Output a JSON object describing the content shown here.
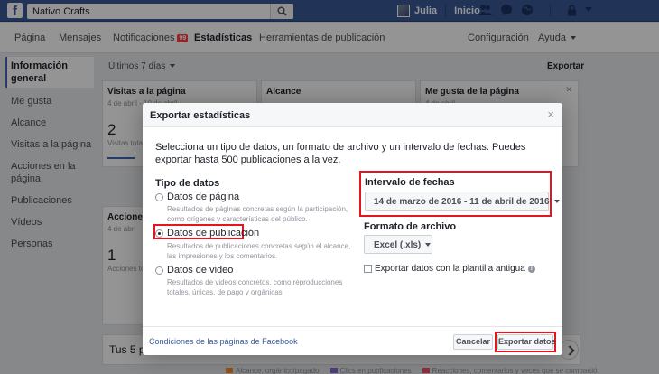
{
  "topbar": {
    "search_value": "Nativo Crafts",
    "user_name": "Julia",
    "home_label": "Inicio"
  },
  "pagenav": {
    "items": [
      "Página",
      "Mensajes",
      "Notificaciones",
      "Estadísticas",
      "Herramientas de publicación"
    ],
    "notif_badge": "99",
    "settings": "Configuración",
    "help": "Ayuda"
  },
  "sidebar": {
    "items": [
      "Información general",
      "Me gusta",
      "Alcance",
      "Visitas a la página",
      "Acciones en la página",
      "Publicaciones",
      "Vídeos",
      "Personas"
    ]
  },
  "main": {
    "range": "Últimos 7 días",
    "export": "Exportar",
    "cards": [
      {
        "title": "Visitas a la página",
        "sub": "4 de abril - 10 de abril",
        "value": "2",
        "small": "Visitas tota"
      },
      {
        "title": "Alcance",
        "sub": "",
        "value": "",
        "small": ""
      },
      {
        "title": "Me gusta de la página",
        "sub": "4 de abril",
        "value": "",
        "small": ""
      },
      {
        "title": "Accione",
        "sub": "4 de abri",
        "value": "1",
        "small": "Acciones to"
      }
    ],
    "bottom_title": "Tus 5 p",
    "legend": [
      "Alcance: orgánico/pagado",
      "Clics en publicaciones",
      "Reacciones, comentarios y veces que se compartió"
    ]
  },
  "modal": {
    "title": "Exportar estadísticas",
    "close": "×",
    "intro": "Selecciona un tipo de datos, un formato de archivo y un intervalo de fechas. Puedes exportar hasta 500 publicaciones a la vez.",
    "data_type_title": "Tipo de datos",
    "options": [
      {
        "label": "Datos de página",
        "desc": "Resultados de páginas concretas según la participación, como orígenes y características del público."
      },
      {
        "label": "Datos de publicación",
        "desc": "Resultados de publicaciones concretas según el alcance, las impresiones y los comentarios."
      },
      {
        "label": "Datos de video",
        "desc": "Resultados de videos concretos, como reproducciones totales, únicas, de pago y orgánicas"
      }
    ],
    "selected_option": 1,
    "date_range_title": "Intervalo de fechas",
    "date_range_value": "14 de marzo de 2016 - 11 de abril de 2016",
    "format_title": "Formato de archivo",
    "format_value": "Excel (.xls)",
    "legacy_checkbox": "Exportar datos con la plantilla antigua",
    "footer_link": "Condiciones de las páginas de Facebook",
    "cancel": "Cancelar",
    "export": "Exportar datos"
  },
  "colors": {
    "brand": "#3b5998",
    "highlight": "#e4151f",
    "legend": [
      "#f7923a",
      "#8b6bd9",
      "#f35369"
    ]
  }
}
